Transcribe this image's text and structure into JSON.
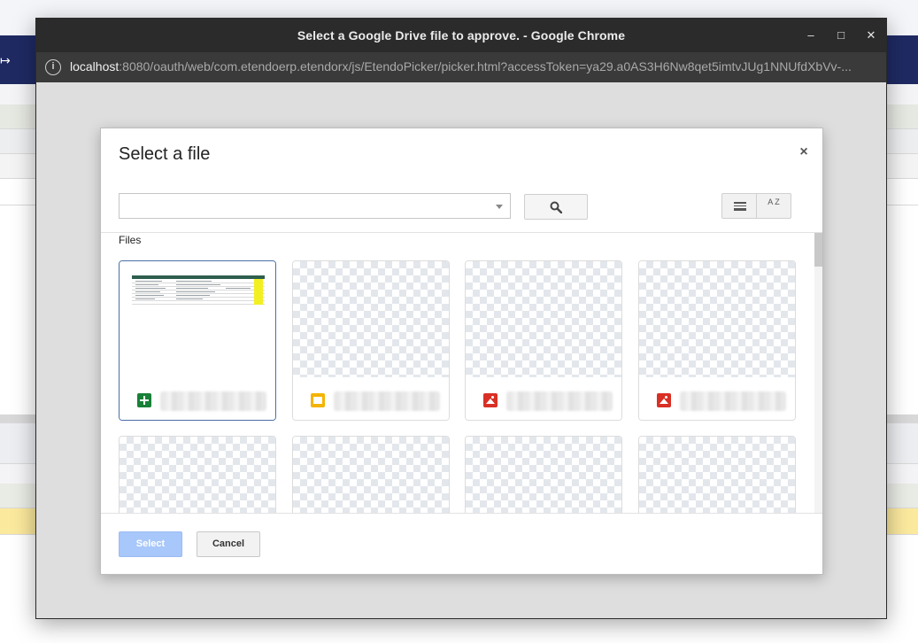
{
  "window": {
    "title": "Select a Google Drive file to approve. - Google Chrome",
    "controls": {
      "minimize": "–",
      "maximize": "□",
      "close": "✕"
    }
  },
  "address_bar": {
    "info_glyph": "i",
    "host": "localhost",
    "rest": ":8080/oauth/web/com.etendoerp.etendorx/js/EtendoPicker/picker.html?accessToken=ya29.a0AS3H6Nw8qet5imtvJUg1NNUfdXbVv-..."
  },
  "background_app": {
    "nav_arrow": "↦"
  },
  "picker": {
    "title": "Select a file",
    "close_glyph": "×",
    "search": {
      "value": "",
      "placeholder": ""
    },
    "sort_label": "A Z",
    "section_label": "Files",
    "files": [
      {
        "type": "spreadsheet",
        "icon": "sheets-icon",
        "selected": true
      },
      {
        "type": "presentation",
        "icon": "slides-icon",
        "selected": false
      },
      {
        "type": "image",
        "icon": "image-icon",
        "selected": false
      },
      {
        "type": "image",
        "icon": "image-icon",
        "selected": false
      },
      {
        "type": "unknown",
        "icon": "",
        "selected": false
      },
      {
        "type": "unknown",
        "icon": "",
        "selected": false
      },
      {
        "type": "unknown",
        "icon": "",
        "selected": false
      },
      {
        "type": "unknown",
        "icon": "",
        "selected": false
      }
    ],
    "buttons": {
      "select": "Select",
      "cancel": "Cancel"
    }
  },
  "colors": {
    "select_button": "#a8c7fa",
    "selected_border": "#4a6fa5",
    "sheets": "#188038",
    "slides": "#f4b400",
    "image": "#d93025",
    "navbar": "#1f2a63"
  }
}
